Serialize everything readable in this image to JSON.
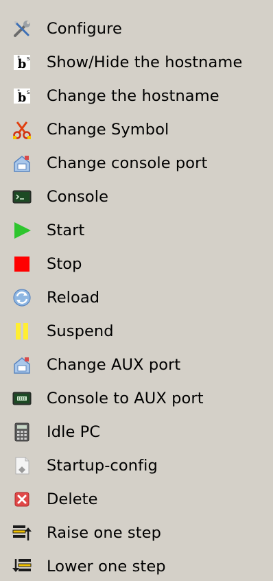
{
  "menu": {
    "items": [
      {
        "label": "Configure",
        "icon": "wrench-screwdriver-icon"
      },
      {
        "label": "Show/Hide the hostname",
        "icon": "hostname-text-icon"
      },
      {
        "label": "Change the hostname",
        "icon": "hostname-text-icon"
      },
      {
        "label": "Change Symbol",
        "icon": "scissors-icon"
      },
      {
        "label": "Change console port",
        "icon": "network-port-icon"
      },
      {
        "label": "Console",
        "icon": "terminal-icon"
      },
      {
        "label": "Start",
        "icon": "play-icon"
      },
      {
        "label": "Stop",
        "icon": "stop-icon"
      },
      {
        "label": "Reload",
        "icon": "reload-icon"
      },
      {
        "label": "Suspend",
        "icon": "pause-icon"
      },
      {
        "label": "Change AUX port",
        "icon": "network-port-icon"
      },
      {
        "label": "Console to AUX port",
        "icon": "aux-console-icon"
      },
      {
        "label": "Idle PC",
        "icon": "calculator-icon"
      },
      {
        "label": "Startup-config",
        "icon": "config-document-icon"
      },
      {
        "label": "Delete",
        "icon": "delete-icon"
      },
      {
        "label": "Raise one step",
        "icon": "raise-layer-icon"
      },
      {
        "label": "Lower one step",
        "icon": "lower-layer-icon"
      }
    ],
    "colors": {
      "background": "#d4d0c8",
      "start": "#2ec52e",
      "stop": "#ff0000",
      "suspend": "#ffee33"
    }
  }
}
